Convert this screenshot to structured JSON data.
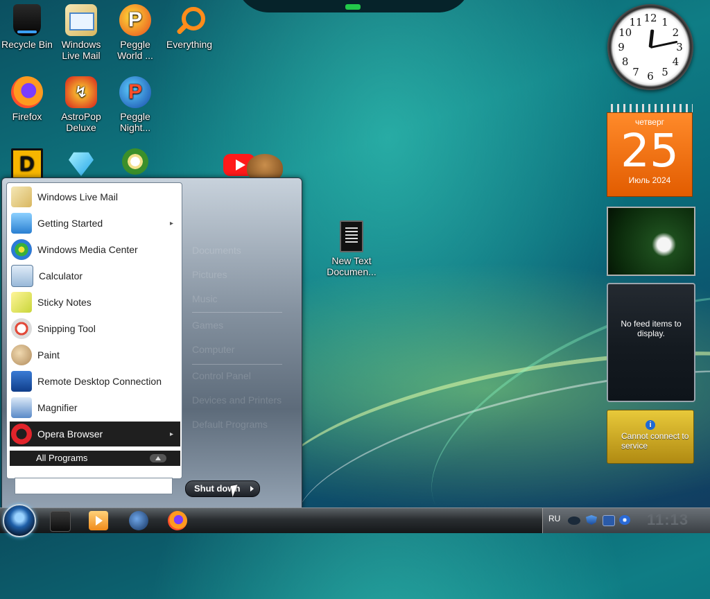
{
  "desktop": {
    "icons": {
      "recycle_bin": "Recycle Bin",
      "windows_live_mail": "Windows Live Mail",
      "peggle_world": "Peggle World ...",
      "everything": "Everything",
      "firefox": "Firefox",
      "astropop": "AstroPop Deluxe",
      "peggle_nights": "Peggle Night...",
      "new_text_doc": "New Text Documen..."
    }
  },
  "gadgets": {
    "clock": {
      "numbers": [
        "12",
        "1",
        "2",
        "3",
        "4",
        "5",
        "6",
        "7",
        "8",
        "9",
        "10",
        "11"
      ],
      "hour": 12,
      "minute": 13
    },
    "calendar": {
      "weekday": "четверг",
      "day": "25",
      "month_year": "Июль 2024"
    },
    "feed": {
      "message": "No feed items to display."
    },
    "weather": {
      "info_glyph": "i",
      "message": "Cannot connect to service"
    }
  },
  "start_menu": {
    "programs": [
      {
        "label": "Windows Live Mail",
        "icon": "mail-icon",
        "submenu": false
      },
      {
        "label": "Getting Started",
        "icon": "getting-started-icon",
        "submenu": true
      },
      {
        "label": "Windows Media Center",
        "icon": "media-center-icon",
        "submenu": false
      },
      {
        "label": "Calculator",
        "icon": "calculator-icon",
        "submenu": false
      },
      {
        "label": "Sticky Notes",
        "icon": "sticky-notes-icon",
        "submenu": false
      },
      {
        "label": "Snipping Tool",
        "icon": "snipping-tool-icon",
        "submenu": false
      },
      {
        "label": "Paint",
        "icon": "paint-icon",
        "submenu": false
      },
      {
        "label": "Remote Desktop Connection",
        "icon": "remote-desktop-icon",
        "submenu": false
      },
      {
        "label": "Magnifier",
        "icon": "magnifier-icon",
        "submenu": false
      },
      {
        "label": "Opera Browser",
        "icon": "opera-icon",
        "submenu": true,
        "selected": true
      }
    ],
    "all_programs": "All Programs",
    "search_placeholder": "",
    "right_items": [
      "Documents",
      "Pictures",
      "Music",
      "Games",
      "Computer",
      "Control Panel",
      "Devices and Printers",
      "Default Programs"
    ],
    "shutdown": "Shut down",
    "submenu_arrow": "▸"
  },
  "taskbar": {
    "language": "RU",
    "time": "11:13"
  }
}
